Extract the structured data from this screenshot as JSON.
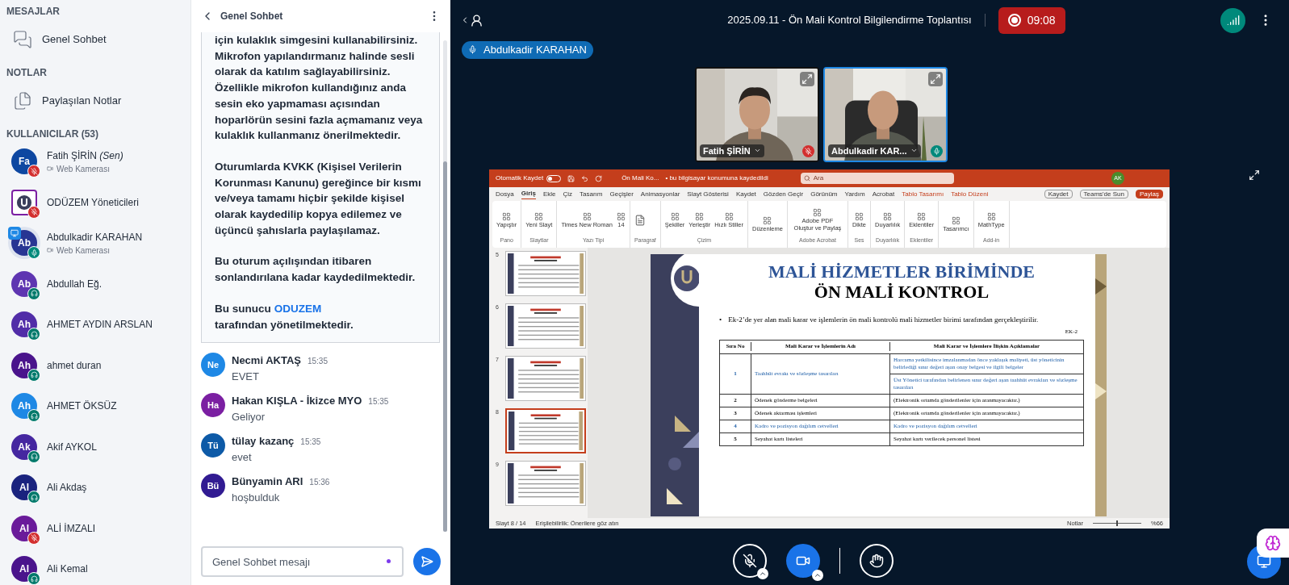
{
  "sidebar": {
    "sections": [
      {
        "heading": "MESAJLAR",
        "item": {
          "kind": "chat",
          "label": "Genel Sohbet"
        }
      },
      {
        "heading": "NOTLAR",
        "item": {
          "kind": "notes",
          "label": "Paylaşılan Notlar"
        }
      }
    ],
    "users_heading": "KULLANICILAR (53)",
    "users": [
      {
        "name": "Fatih ŞİRİN *(Sen)*",
        "initials": "Fa",
        "color": "#0d47a1",
        "mic_muted": true,
        "sub": "Web Kamerası",
        "presenter": false,
        "kind": "initials"
      },
      {
        "name": "ODÜZEM Yöneticileri",
        "color": "#7b1fa2",
        "mic_muted": true,
        "presenter": false,
        "kind": "logo"
      },
      {
        "name": "Abdulkadir KARAHAN",
        "initials": "Ab",
        "color": "#283593",
        "mic_muted": false,
        "listen_only": false,
        "sub": "Web Kamerası",
        "presenter": true,
        "kind": "initials"
      },
      {
        "name": "Abdullah Eğ.",
        "initials": "Ab",
        "color": "#5e35b1",
        "mic_muted": false,
        "listen_only": true,
        "presenter": false,
        "kind": "initials"
      },
      {
        "name": "AHMET AYDIN ARSLAN",
        "initials": "Ah",
        "color": "#512da8",
        "mic_muted": false,
        "listen_only": true,
        "presenter": false,
        "kind": "initials"
      },
      {
        "name": "ahmet duran",
        "initials": "Ah",
        "color": "#4a148c",
        "mic_muted": false,
        "listen_only": true,
        "presenter": false,
        "kind": "initials"
      },
      {
        "name": "AHMET ÖKSÜZ",
        "initials": "Ah",
        "color": "#1e88e5",
        "mic_muted": false,
        "listen_only": true,
        "presenter": false,
        "kind": "initials"
      },
      {
        "name": "Akif AYKOL",
        "initials": "Ak",
        "color": "#4527a0",
        "mic_muted": false,
        "listen_only": true,
        "presenter": false,
        "kind": "initials"
      },
      {
        "name": "Ali Akdaş",
        "initials": "Al",
        "color": "#1a237e",
        "mic_muted": false,
        "listen_only": true,
        "presenter": false,
        "kind": "initials"
      },
      {
        "name": "ALİ İMZALI",
        "initials": "Al",
        "color": "#6a1b9a",
        "mic_muted": true,
        "presenter": false,
        "kind": "initials"
      },
      {
        "name": "Ali Kemal",
        "initials": "Al",
        "color": "#4a148c",
        "mic_muted": false,
        "listen_only": true,
        "presenter": false,
        "kind": "initials"
      }
    ]
  },
  "chat": {
    "title": "Genel Sohbet",
    "welcome": {
      "paragraphs": [
        "için kulaklık simgesini kullanabilirsiniz. Mikrofon yapılandırmanız halinde sesli olarak da katılım sağlayabilirsiniz. Özellikle mikrofon kullandığınız anda sesin eko yapmaması açısından hoparlörün sesini fazla açmamanız veya kulaklık kullanmanız önerilmektedir.",
        "Oturumlarda KVKK (Kişisel Verilerin Korunması Kanunu) gereğince bir kısmı ve/veya tamamı hiçbir şekilde kişisel olarak kaydedilip kopya edilemez ve üçüncü şahıslarla paylaşılamaz.",
        "Bu oturum açılışından itibaren sonlandırılana kadar kaydedilmektedir."
      ],
      "last": {
        "before": "Bu sunucu",
        "link": "ODUZEM",
        "after": "tarafından yönetilmektedir."
      }
    },
    "messages": [
      {
        "initials": "Ne",
        "color": "#1e88e5",
        "name": "Necmi AKTAŞ",
        "time": "15:35",
        "text": "EVET"
      },
      {
        "initials": "Ha",
        "color": "#7b1fa2",
        "name": "Hakan KIŞLA - İkizce MYO",
        "time": "15:35",
        "text": "Geliyor"
      },
      {
        "initials": "Tü",
        "color": "#0d5aa7",
        "name": "tülay kazanç",
        "time": "15:35",
        "text": "evet"
      },
      {
        "initials": "Bü",
        "color": "#311b92",
        "name": "Bünyamin ARI",
        "time": "15:36",
        "text": "hoşbulduk"
      }
    ],
    "input": {
      "placeholder": "Genel Sohbet mesajı"
    }
  },
  "meeting": {
    "title": "2025.09.11 - Ön Mali Kontrol Bilgilendirme Toplantısı",
    "recording": true,
    "timer": "09:08",
    "presenter": "Abdulkadir KARAHAN",
    "videos": [
      {
        "name": "Fatih ŞİRİN",
        "mic_muted": true,
        "active": false
      },
      {
        "name": "Abdulkadir KAR...",
        "mic_muted": false,
        "active": true
      }
    ],
    "controls": {
      "mic_muted": true,
      "camera_on": true
    }
  },
  "screen": {
    "titlebar": {
      "autosave": "Otomatik Kaydet",
      "autosave_on": false,
      "file": "Ön Mali Ko...",
      "saved": "• bu bilgisayar konumuna kaydedildi",
      "search": "Ara",
      "account": "AK"
    },
    "tabs": [
      {
        "label": "Dosya",
        "selected": false,
        "kind": "normal"
      },
      {
        "label": "Giriş",
        "selected": true,
        "kind": "normal"
      },
      {
        "label": "Ekle",
        "selected": false,
        "kind": "normal"
      },
      {
        "label": "Çiz",
        "selected": false,
        "kind": "normal"
      },
      {
        "label": "Tasarım",
        "selected": false,
        "kind": "normal"
      },
      {
        "label": "Geçişler",
        "selected": false,
        "kind": "normal"
      },
      {
        "label": "Animasyonlar",
        "selected": false,
        "kind": "normal"
      },
      {
        "label": "Slayt Gösterisi",
        "selected": false,
        "kind": "normal"
      },
      {
        "label": "Kaydet",
        "selected": false,
        "kind": "normal"
      },
      {
        "label": "Gözden Geçir",
        "selected": false,
        "kind": "normal"
      },
      {
        "label": "Görünüm",
        "selected": false,
        "kind": "normal"
      },
      {
        "label": "Yardım",
        "selected": false,
        "kind": "normal"
      },
      {
        "label": "Acrobat",
        "selected": false,
        "kind": "normal"
      },
      {
        "label": "Tablo Tasarımı",
        "selected": false,
        "kind": "context"
      },
      {
        "label": "Tablo Düzeni",
        "selected": false,
        "kind": "context"
      }
    ],
    "tab_buttons": [
      "Kaydet",
      "Teams'de Sun",
      "Paylaş"
    ],
    "ribbon_groups": [
      {
        "label": "Pano",
        "buttons": [
          "Yapıştır"
        ]
      },
      {
        "label": "Slaytlar",
        "buttons": [
          "Yeni Slayt"
        ]
      },
      {
        "label": "Yazı Tipi",
        "buttons": [
          "Times New Roman",
          "14"
        ]
      },
      {
        "label": "Paragraf"
      },
      {
        "label": "Çizim",
        "buttons": [
          "Şekiller",
          "Yerleştir",
          "Hızlı Stiller"
        ]
      },
      {
        "buttons": [
          "Düzenleme"
        ]
      },
      {
        "label": "Adobe Acrobat",
        "buttons": [
          "Adobe PDF Oluştur ve Paylaş"
        ]
      },
      {
        "label": "Ses",
        "buttons": [
          "Dikte"
        ]
      },
      {
        "label": "Duyarlılık",
        "buttons": [
          "Duyarlılık"
        ]
      },
      {
        "label": "Eklentiler",
        "buttons": [
          "Eklentiler"
        ]
      },
      {
        "buttons": [
          "Tasarımcı"
        ]
      },
      {
        "label": "Add-in",
        "buttons": [
          "MathType"
        ]
      }
    ],
    "thumbnails": [
      {
        "number": "5",
        "selected": false
      },
      {
        "number": "6",
        "selected": false
      },
      {
        "number": "7",
        "selected": false
      },
      {
        "number": "8",
        "selected": true
      },
      {
        "number": "9",
        "selected": false
      }
    ],
    "slide": {
      "title_1": "MALİ HİZMETLER BİRİMİNDE",
      "title_2": "ÖN MALİ KONTROL",
      "bullet_mark": "•",
      "bullet": "Ek-2’de yer alan mali karar ve işlemlerin ön mali kontrolü mali hizmetler birimi tarafından gerçekleştirilir.",
      "table_note": "EK-2",
      "columns": [
        "Sıra No",
        "Mali Karar ve İşlemlerin Adı",
        "Mali Karar ve İşlemlere İlişkin Açıklamalar"
      ],
      "rows": [
        {
          "no": "1",
          "name": "Taahhüt evrakı ve sözleşme tasarıları",
          "descriptions": [
            "Harcama yetkilisince imzalanmadan önce yaklaşık maliyeti, üst yöneticinin belirlediği sınır değeri aşan onay belgesi ve ilgili belgeler",
            "Üst Yönetici tarafından belirlenen sınır değeri aşan taahhüt evrakları ve sözleşme tasarıları"
          ],
          "highlight": true
        },
        {
          "no": "2",
          "name": "Ödenek gönderme belgeleri",
          "descriptions": [
            "(Elektronik ortamda gönderilenler için aranmayacaktır.)"
          ],
          "highlight": false
        },
        {
          "no": "3",
          "name": "Ödenek aktarması işlemleri",
          "descriptions": [
            "(Elektronik ortamda gönderilenler için aranmayacaktır.)"
          ],
          "highlight": false
        },
        {
          "no": "4",
          "name": "Kadro ve pozisyon dağılım cetvelleri",
          "descriptions": [
            "Kadro ve pozisyon dağılım cetvelleri"
          ],
          "highlight": true
        },
        {
          "no": "5",
          "name": "Seyahat kartı listeleri",
          "descriptions": [
            "Seyahat kartı verilecek personel listesi"
          ],
          "highlight": false
        }
      ]
    },
    "status": {
      "slide": "Slayt 8 / 14",
      "accessibility": "Erişilebilirlik: Önerilere göz atın",
      "notes": "Notlar",
      "zoom_slider": {
        "level": 0.5
      },
      "zoom": "%66"
    }
  }
}
